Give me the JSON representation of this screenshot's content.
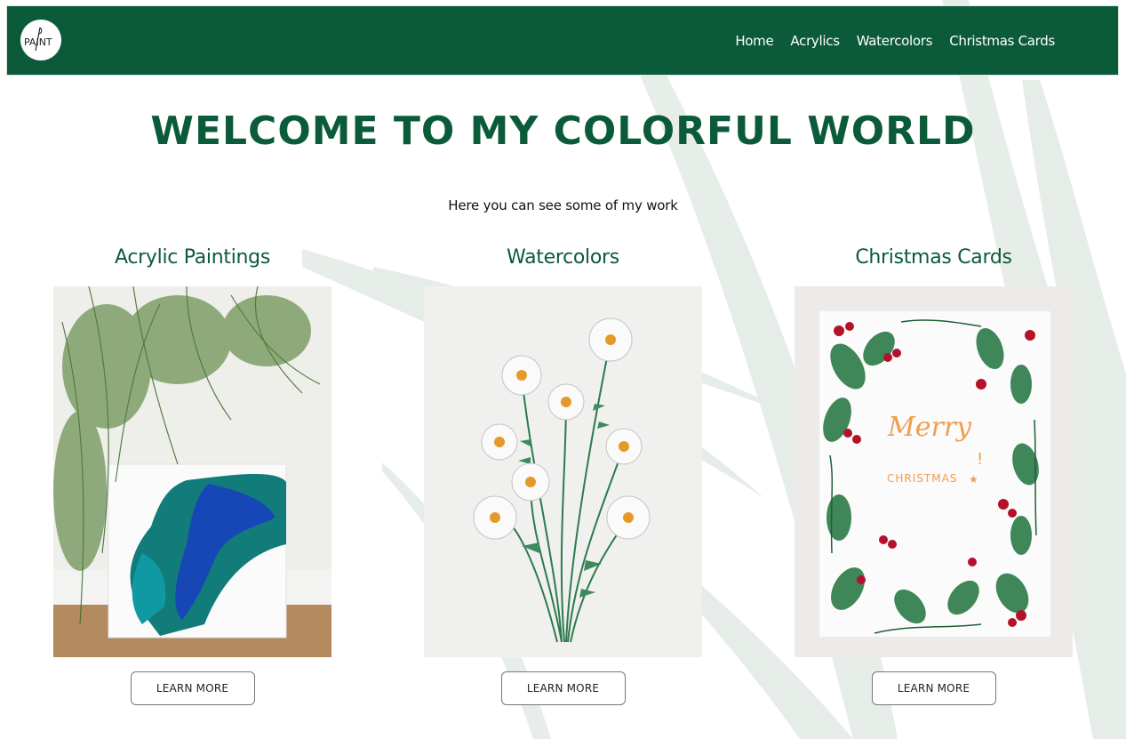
{
  "logo": {
    "text": "PAINT"
  },
  "nav": {
    "items": [
      "Home",
      "Acrylics",
      "Watercolors",
      "Christmas Cards"
    ]
  },
  "hero": {
    "title": "WELCOME TO MY COLORFUL WORLD",
    "subtitle": "Here you can see some of my work"
  },
  "cards": [
    {
      "title": "Acrylic Paintings",
      "button": "LEARN MORE"
    },
    {
      "title": "Watercolors",
      "button": "LEARN MORE"
    },
    {
      "title": "Christmas Cards",
      "button": "LEARN MORE"
    }
  ],
  "christmas_card": {
    "line1": "Merry",
    "line2": "CHRISTMAS"
  },
  "colors": {
    "brand_green": "#0b5b3a",
    "nav_text": "#ffffff",
    "button_border": "#777777"
  }
}
